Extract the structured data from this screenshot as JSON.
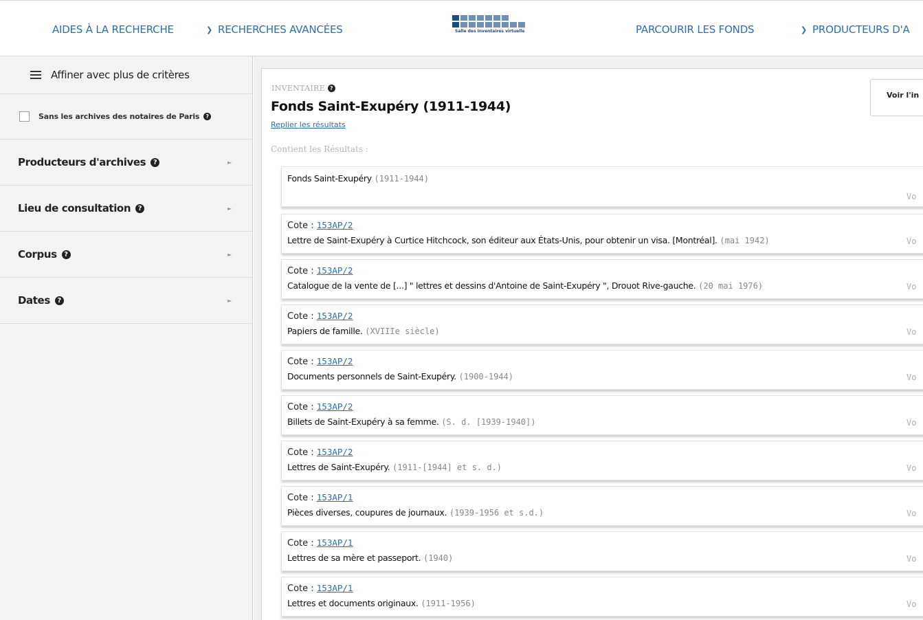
{
  "nav": {
    "aides": "AIDES À LA RECHERCHE",
    "recherches": "RECHERCHES AVANCÉES",
    "parcourir": "PARCOURIR LES FONDS",
    "producteurs": "PRODUCTEURS D'A",
    "logo_caption": "Salle des Inventaires virtuelle",
    "chevron_icon": "chevron-down-icon",
    "accent_color": "#2d6fae"
  },
  "sidebar": {
    "title": "Affiner avec plus de critères",
    "checkbox_label": "Sans les archives des notaires de Paris",
    "checkbox_checked": false,
    "facets": [
      {
        "label": "Producteurs d'archives"
      },
      {
        "label": "Lieu de consultation"
      },
      {
        "label": "Corpus"
      },
      {
        "label": "Dates"
      }
    ]
  },
  "main": {
    "kicker": "INVENTAIRE",
    "title": "Fonds Saint-Exupéry (1911-1944)",
    "collapse_link": "Replier les résultats",
    "contains_label": "Contient les Résultats :",
    "voir_button": "Voir l'in",
    "voir_text": "Vo",
    "first_result": {
      "title": "Fonds Saint-Exupéry",
      "date": "(1911-1944)"
    },
    "cote_label": "Cote : ",
    "results": [
      {
        "cote": "153AP/2",
        "title": "Lettre de Saint-Exupéry à Curtice Hitchcock, son éditeur aux États-Unis, pour obtenir un visa. [Montréal].",
        "date": "(mai 1942)"
      },
      {
        "cote": "153AP/2",
        "title": "Catalogue de la vente de [...] \" lettres et dessins d'Antoine de Saint-Exupéry \", Drouot Rive-gauche.",
        "date": "(20 mai 1976)"
      },
      {
        "cote": "153AP/2",
        "title": "Papiers de famille.",
        "date": "(XVIIIe siècle)"
      },
      {
        "cote": "153AP/2",
        "title": "Documents personnels de Saint-Exupéry.",
        "date": "(1900-1944)"
      },
      {
        "cote": "153AP/2",
        "title": "Billets de Saint-Exupéry à sa femme.",
        "date": "(S. d. [1939-1940])"
      },
      {
        "cote": "153AP/2",
        "title": "Lettres de Saint-Exupéry.",
        "date": "(1911-[1944] et s. d.)"
      },
      {
        "cote": "153AP/1",
        "title": "Pièces diverses, coupures de journaux.",
        "date": "(1939-1956 et s.d.)"
      },
      {
        "cote": "153AP/1",
        "title": "Lettres de sa mère et passeport.",
        "date": "(1940)"
      },
      {
        "cote": "153AP/1",
        "title": "Lettres et documents originaux.",
        "date": "(1911-1956)"
      }
    ]
  }
}
